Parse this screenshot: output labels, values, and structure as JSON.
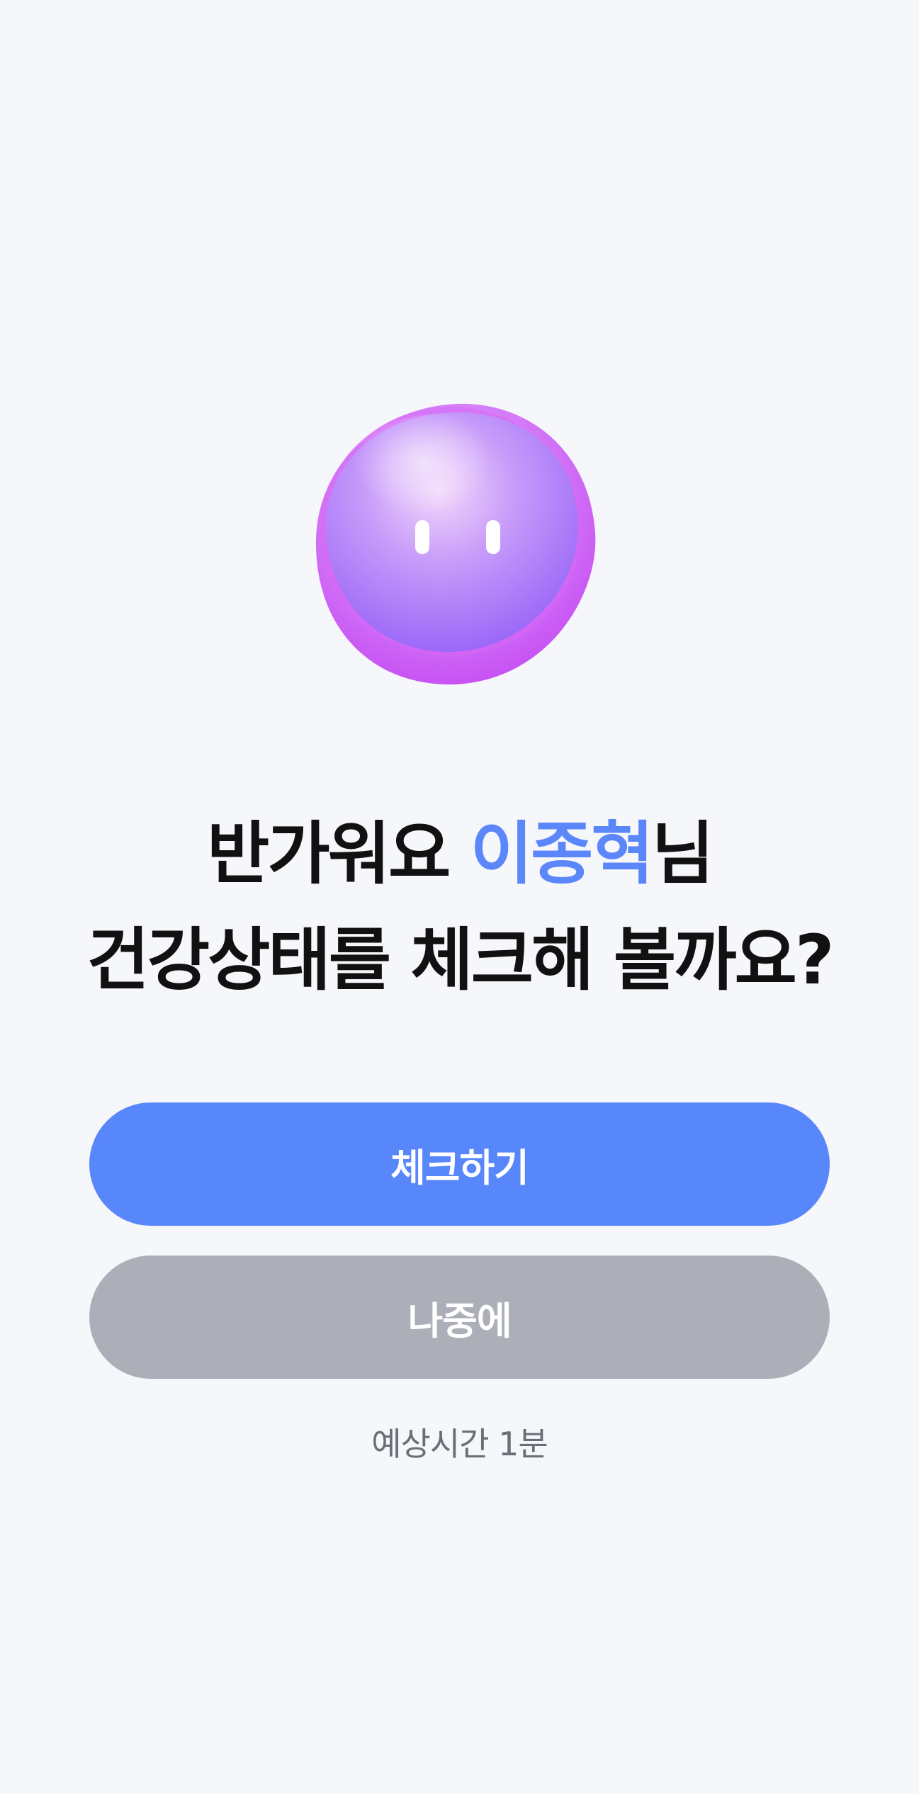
{
  "greeting": {
    "prefix": "반가워요 ",
    "name": "이종혁",
    "suffix": "님",
    "line2": "건강상태를 체크해 볼까요?"
  },
  "buttons": {
    "check_label": "체크하기",
    "later_label": "나중에"
  },
  "eta_text": "예상시간 1분",
  "colors": {
    "background": "#f5f7fb",
    "accent": "#5887fc",
    "name_highlight": "#5b87fa",
    "secondary_button": "#acafb8",
    "mascot": "#b56cf6"
  },
  "icons": {
    "mascot": "purple-blob-mascot-icon"
  }
}
